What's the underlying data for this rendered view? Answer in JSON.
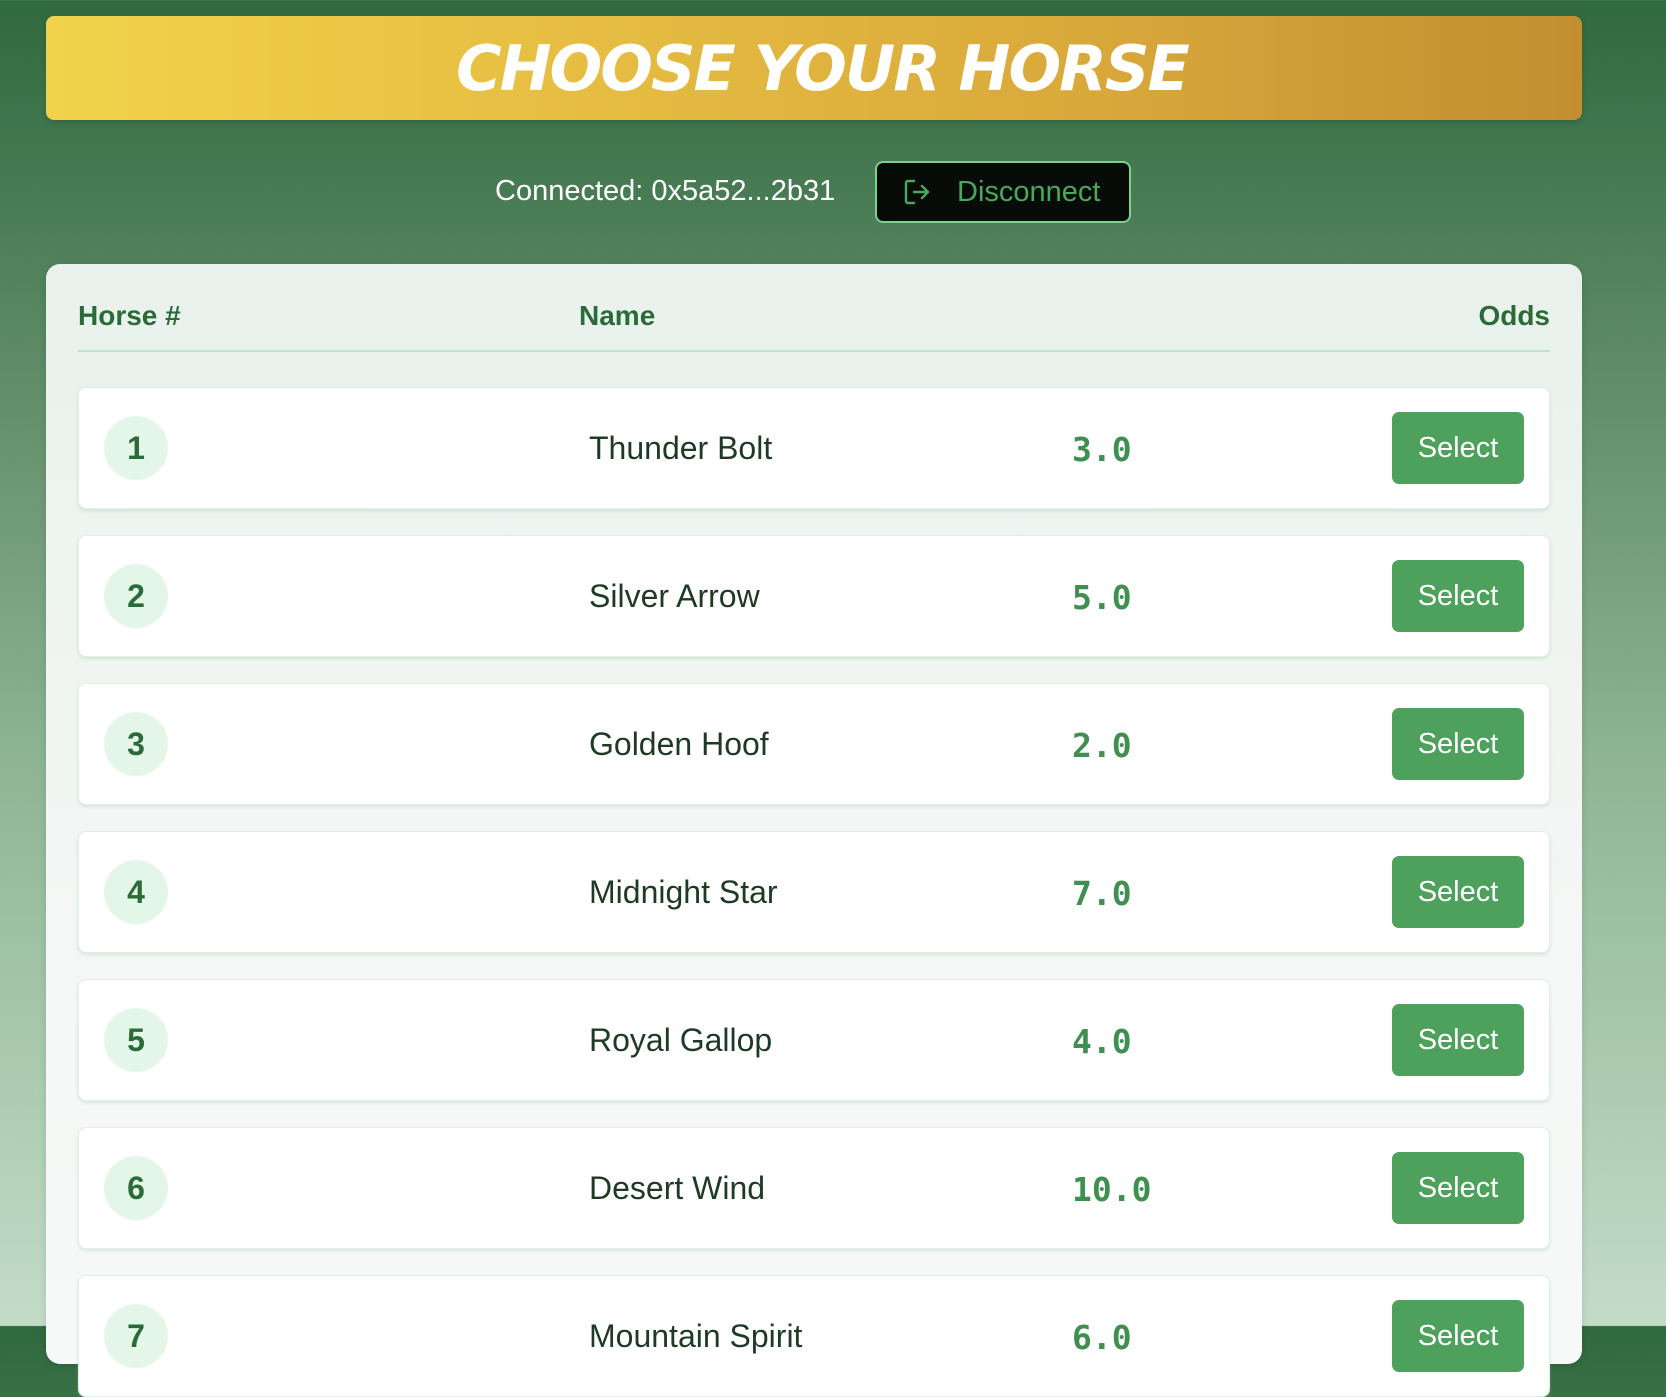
{
  "header": {
    "title": "CHOOSE YOUR HORSE"
  },
  "wallet": {
    "connected_text": "Connected: 0x5a52...2b31",
    "disconnect_label": "Disconnect",
    "disconnect_icon": "logout-icon"
  },
  "table": {
    "columns": {
      "number": "Horse #",
      "name": "Name",
      "odds": "Odds"
    },
    "rows": [
      {
        "number": "1",
        "name": "Thunder Bolt",
        "odds": "3.0",
        "action": "Select"
      },
      {
        "number": "2",
        "name": "Silver Arrow",
        "odds": "5.0",
        "action": "Select"
      },
      {
        "number": "3",
        "name": "Golden Hoof",
        "odds": "2.0",
        "action": "Select"
      },
      {
        "number": "4",
        "name": "Midnight Star",
        "odds": "7.0",
        "action": "Select"
      },
      {
        "number": "5",
        "name": "Royal Gallop",
        "odds": "4.0",
        "action": "Select"
      },
      {
        "number": "6",
        "name": "Desert Wind",
        "odds": "10.0",
        "action": "Select"
      },
      {
        "number": "7",
        "name": "Mountain Spirit",
        "odds": "6.0",
        "action": "Select"
      }
    ]
  },
  "colors": {
    "banner_start": "#f2d24b",
    "banner_end": "#c28e31",
    "accent_green": "#4ea15c",
    "heading_green": "#2b6b39",
    "odds_green": "#3f8f50"
  }
}
